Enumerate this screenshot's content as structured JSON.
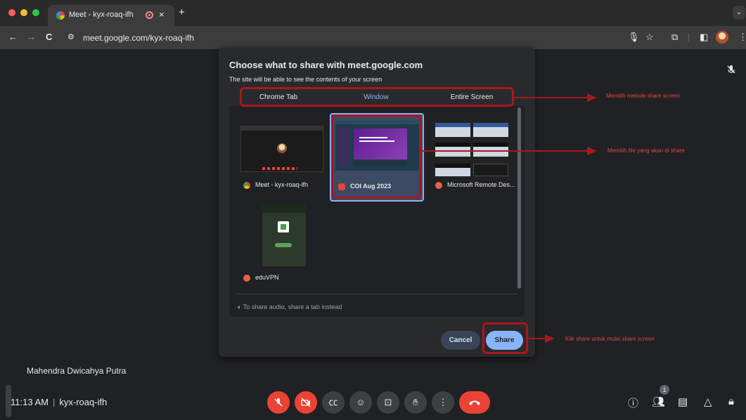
{
  "browser": {
    "tab_title": "Meet - kyx-roaq-ifh",
    "tab_close": "×",
    "new_tab": "+",
    "tab_menu": "⌄",
    "url": "meet.google.com/kyx-roaq-ifh",
    "back": "←",
    "forward": "→",
    "reload": "C"
  },
  "dialog": {
    "title": "Choose what to share with meet.google.com",
    "subtitle": "The site will be able to see the contents of your screen",
    "tabs": [
      "Chrome Tab",
      "Window",
      "Entire Screen"
    ],
    "active_tab": "Window",
    "windows": [
      {
        "label": "Meet - kyx-roaq-ifh",
        "icon": "chrome-icon",
        "selected": false
      },
      {
        "label": "COI Aug 2023",
        "icon": "slides-app-icon",
        "selected": true
      },
      {
        "label": "Microsoft Remote Des...",
        "icon": "remote-desktop-icon",
        "selected": false
      },
      {
        "label": "eduVPN",
        "icon": "eduvpn-icon",
        "selected": false
      }
    ],
    "audio_note": "To share audio, share a tab instead",
    "cancel_label": "Cancel",
    "share_label": "Share"
  },
  "annotations": {
    "method": "Memilih metode share screen",
    "file": "Memilih file yang akan di share",
    "share": "Klik share untuk mulai share screen",
    "color": "#a8181b"
  },
  "meeting": {
    "participant": "Mahendra Dwicahya Putra",
    "time": "11:13 AM",
    "separator": "|",
    "code": "kyx-roaq-ifh",
    "participant_count": "1"
  },
  "colors": {
    "accent": "#8ab4f8",
    "danger": "#ea4335",
    "background": "#202124"
  }
}
